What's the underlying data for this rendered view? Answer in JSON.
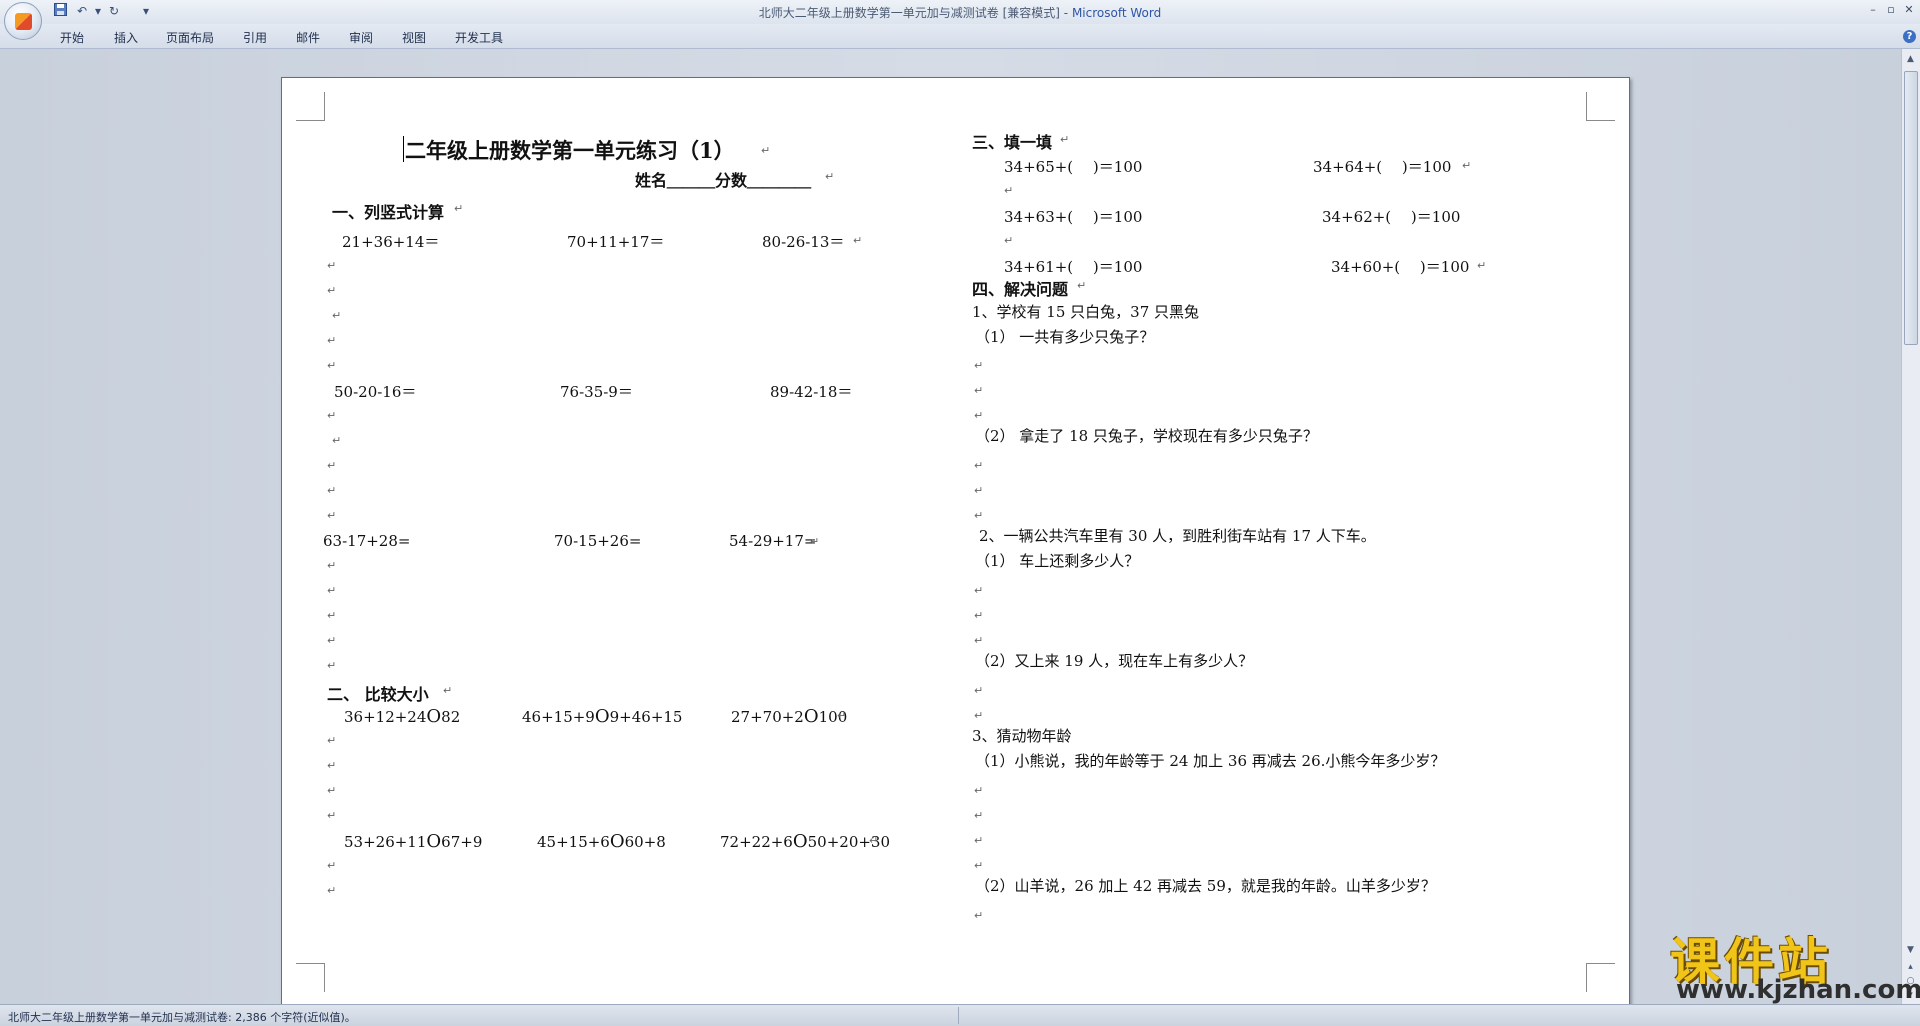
{
  "window": {
    "doc_title": "北师大二年级上册数学第一单元加与减测试卷 [兼容模式]",
    "separator": " - ",
    "app_name": "Microsoft Word",
    "qa_undo": "↶",
    "qa_redo": "↻",
    "qa_more": "▾",
    "minimize": "–",
    "restore": "▫",
    "close": "✕"
  },
  "ribbon_tabs": [
    "开始",
    "插入",
    "页面布局",
    "引用",
    "邮件",
    "审阅",
    "视图",
    "开发工具"
  ],
  "help": "?",
  "document": {
    "title": "二年级上册数学第一单元练习（1）",
    "name_score": "姓名＿＿＿分数＿＿＿＿",
    "sec1_heading": "一、列竖式计算",
    "sec1_row1": [
      "21+36+14＝",
      "70+11+17＝",
      "80-26-13＝"
    ],
    "sec1_row2": [
      "50-20-16＝",
      "76-35-9＝",
      "89-42-18＝"
    ],
    "sec1_row3": [
      "63-17+28=",
      "70-15+26=",
      "54-29+17="
    ],
    "sec2_heading": "二、 比较大小",
    "sec2_row1": [
      "36+12+24",
      "82",
      "46+15+9",
      "9+46+15",
      "27+70+2",
      "100"
    ],
    "sec2_row2": [
      "53+26+11",
      "67+9",
      "45+15+6",
      "60+8",
      "72+22+6",
      "50+20+30"
    ],
    "circle": "O",
    "sec3_heading": "三、填一填",
    "sec3_rows": [
      [
        "34+65+(　 )＝100",
        "34+64+(　 )＝100"
      ],
      [
        "34+63+(　 )＝100",
        "34+62+(　 )＝100"
      ],
      [
        "34+61+(　 )＝100",
        "34+60+(　 )＝100"
      ]
    ],
    "sec4_heading": "四、解决问题",
    "q1": "1、学校有 15 只白兔，37 只黑兔",
    "q1_1": "（1） 一共有多少只兔子？",
    "q1_2": "（2） 拿走了 18 只兔子，学校现在有多少只兔子？",
    "q2": "2、一辆公共汽车里有 30 人，到胜利街车站有 17 人下车。",
    "q2_1": "（1） 车上还剩多少人？",
    "q2_2": "（2）又上来 19 人，现在车上有多少人？",
    "q3": "3、猜动物年龄",
    "q3_1": "（1）小熊说，我的年龄等于 24 加上 36 再减去 26.小熊今年多少岁？",
    "q3_2": "（2）山羊说，26 加上 42 再减去 59，就是我的年龄。山羊多少岁？",
    "para_mark": "↵"
  },
  "status": {
    "text": "北师大二年级上册数学第一单元加与减测试卷: 2,386 个字符(近似值)。"
  },
  "watermark": {
    "cn": "课件站",
    "url": "www.kjzhan.com"
  },
  "colors": {
    "app_blue": "#2e55a5",
    "workspace": "#cfd6e0",
    "watermark_gold": "#f0c419"
  }
}
